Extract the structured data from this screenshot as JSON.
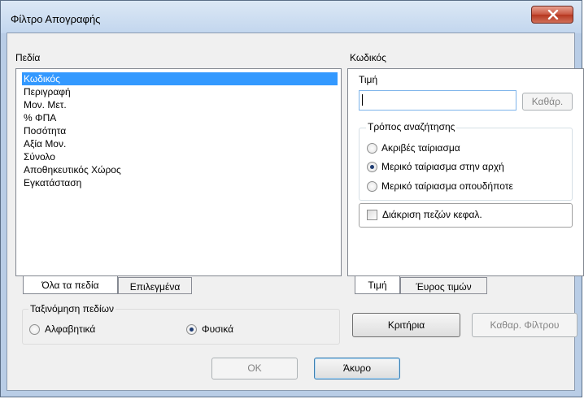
{
  "window": {
    "title": "Φίλτρο Απογραφής"
  },
  "fields": {
    "label": "Πεδία",
    "items": [
      "Κωδικός",
      "Περιγραφή",
      "Μον. Μετ.",
      "% ΦΠΑ",
      "Ποσότητα",
      "Αξία Μον.",
      "Σύνολο",
      "Αποθηκευτικός Χώρος",
      "Εγκατάσταση"
    ],
    "selected_index": 0,
    "tabs": [
      "Όλα τα πεδία",
      "Επιλεγμένα"
    ]
  },
  "sort": {
    "label": "Ταξινόμηση πεδίων",
    "options": [
      "Αλφαβητικά",
      "Φυσικά"
    ],
    "selected": "Φυσικά"
  },
  "criteria": {
    "field_label": "Κωδικός",
    "value_label": "Τιμή",
    "value": "",
    "clear_label": "Καθάρ.",
    "search_mode_label": "Τρόπος αναζήτησης",
    "search_modes": [
      "Ακριβές ταίριασμα",
      "Μερικό ταίριασμα στην αρχή",
      "Μερικό ταίριασμα οπουδήποτε"
    ],
    "selected_mode": "Μερικό ταίριασμα στην αρχή",
    "case_label": "Διάκριση πεζών κεφαλ.",
    "case_checked": false,
    "tabs": [
      "Τιμή",
      "Έυρος τιμών"
    ]
  },
  "buttons": {
    "criteria": "Κριτήρια",
    "clear_filter": "Καθαρ. Φίλτρου",
    "ok": "OK",
    "cancel": "Άκυρο"
  }
}
